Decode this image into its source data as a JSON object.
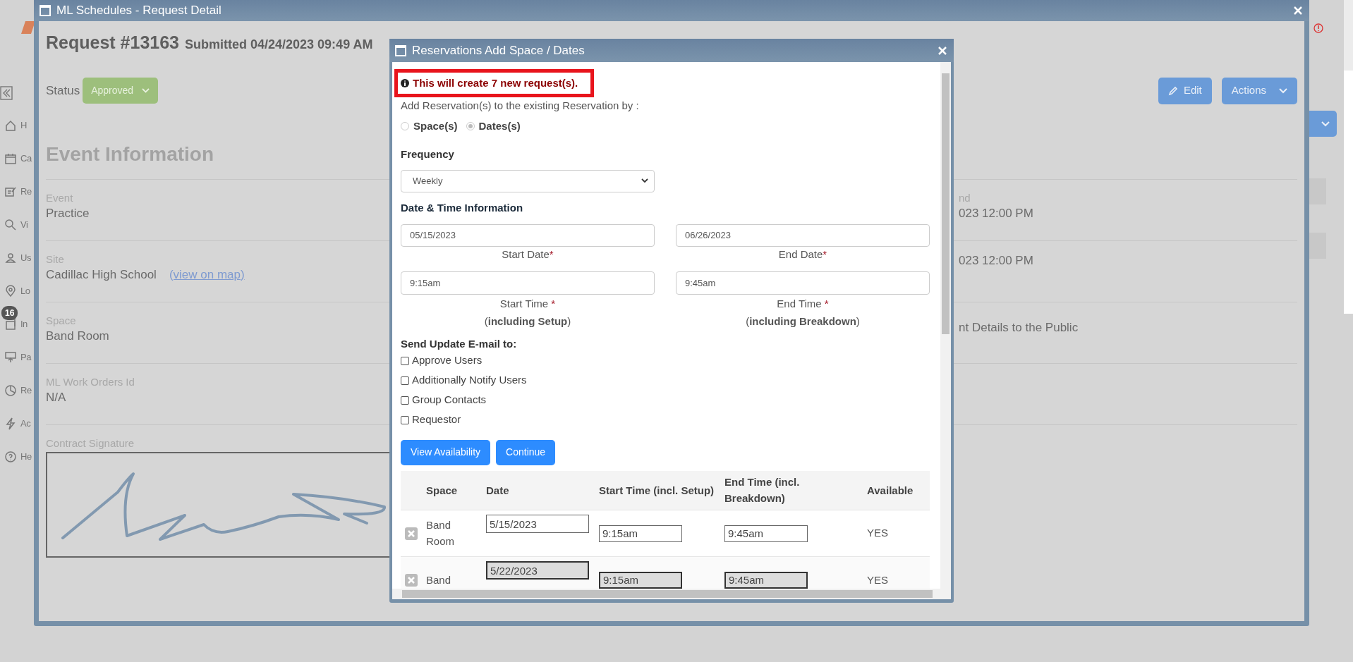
{
  "sidebar": {
    "items": [
      {
        "label": "H"
      },
      {
        "label": "Ca"
      },
      {
        "label": "Re"
      },
      {
        "label": "Vi"
      },
      {
        "label": "Us"
      },
      {
        "label": "Lo"
      },
      {
        "label": "In",
        "badge": "16"
      },
      {
        "label": "Pa"
      },
      {
        "label": "Re"
      },
      {
        "label": "Ac"
      },
      {
        "label": "He"
      }
    ]
  },
  "window": {
    "title": "ML Schedules - Request Detail"
  },
  "request": {
    "title": "Request #13163",
    "submitted": "Submitted 04/24/2023 09:49 AM",
    "status_label": "Status",
    "status": "Approved",
    "buttons": [
      "Edit",
      "Actions"
    ]
  },
  "section_title": "Event Information",
  "fields": [
    {
      "label": "Event",
      "value": "Practice"
    },
    {
      "label": "Site",
      "value": "Cadillac High School",
      "link": "(view on map)"
    },
    {
      "label": "Space",
      "value": "Band Room"
    },
    {
      "label": "ML Work Orders Id",
      "value": "N/A"
    }
  ],
  "right_column": [
    {
      "label": "nd",
      "value": "023 12:00 PM"
    },
    {
      "value": "023 12:00 PM"
    },
    {
      "value": "nt Details to the Public"
    }
  ],
  "signature_label": "Contract Signature",
  "dialog": {
    "title": "Reservations Add Space / Dates",
    "notice": "This will create 7 new request(s).",
    "intro": "Add Reservation(s) to the existing Reservation by :",
    "modes": [
      {
        "label": "Space(s)",
        "selected": false
      },
      {
        "label": "Dates(s)",
        "selected": true
      }
    ],
    "frequency_label": "Frequency",
    "frequency": "Weekly",
    "section": "Date & Time Information",
    "dates": [
      {
        "value": "05/15/2023",
        "label": "Start Date",
        "mark": "*"
      },
      {
        "value": "06/26/2023",
        "label": "End Date",
        "mark": "*"
      }
    ],
    "times": [
      {
        "value": "9:15am",
        "label": "Start Time ",
        "mark": "*",
        "note": "(**including Setup**)"
      },
      {
        "value": "9:45am",
        "label": "End Time ",
        "mark": "*",
        "note": "(**including Breakdown**)"
      }
    ],
    "email_label": "Send Update E-mail to:",
    "email_options": [
      {
        "label": "Approve Users",
        "checked": false
      },
      {
        "label": "Additionally Notify Users",
        "checked": false
      },
      {
        "label": "Group Contacts",
        "checked": false
      },
      {
        "label": "Requestor",
        "checked": false
      }
    ],
    "actions": [
      "View Availability",
      "Continue"
    ],
    "table": {
      "columns": [
        "Space",
        "Date",
        "Start Time (incl. Setup)",
        "End Time (incl. Breakdown)",
        "Available"
      ],
      "rows": [
        {
          "space": "Band Room",
          "date": "5/15/2023",
          "start": "9:15am",
          "end": "9:45am",
          "available": "YES",
          "disabled": false
        },
        {
          "space": "Band",
          "date": "5/22/2023",
          "start": "9:15am",
          "end": "9:45am",
          "available": "YES",
          "disabled": true
        }
      ]
    }
  }
}
